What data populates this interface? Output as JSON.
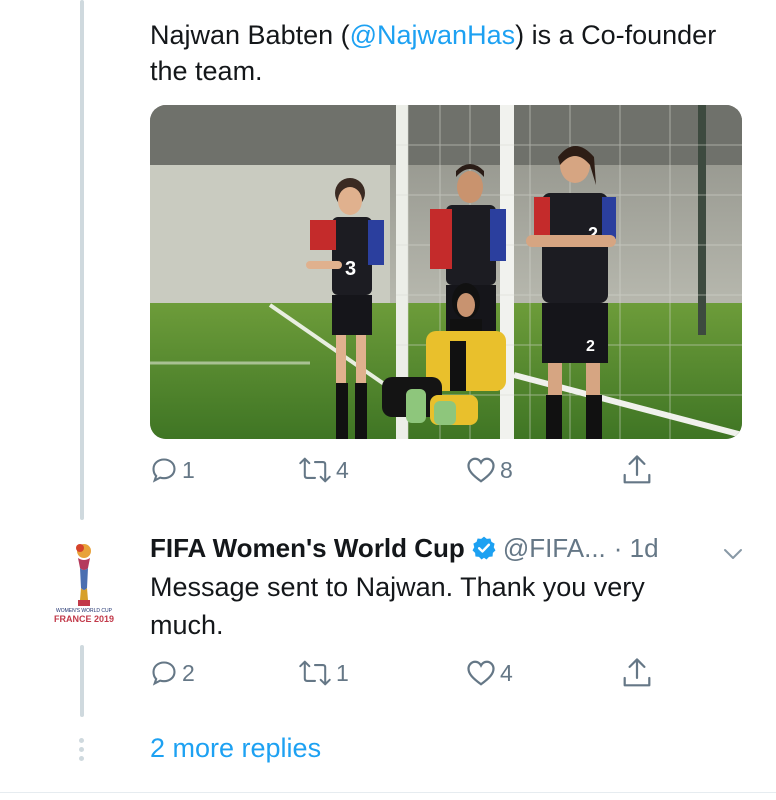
{
  "tweet1": {
    "text_before": "Najwan Babten (",
    "mention": "@NajwanHas",
    "text_after": ") is a Co-founder the team.",
    "photo_alt": "Four girls in football kits posing in front of a goal",
    "actions": {
      "reply_count": "1",
      "retweet_count": "4",
      "like_count": "8"
    }
  },
  "tweet2": {
    "display_name": "FIFA Women's World Cup",
    "handle": "@FIFA...",
    "time": "· 1d",
    "text": "Message sent to Najwan. Thank you very much.",
    "avatar_caption": "FRANCE 2019",
    "actions": {
      "reply_count": "2",
      "retweet_count": "1",
      "like_count": "4"
    }
  },
  "more_replies": "2 more replies",
  "colors": {
    "accent": "#1da1f2",
    "muted": "#657786",
    "thread_line": "#cfd9de"
  },
  "icons": [
    "reply-icon",
    "retweet-icon",
    "like-icon",
    "share-icon",
    "verified-icon",
    "chevron-down-icon"
  ]
}
